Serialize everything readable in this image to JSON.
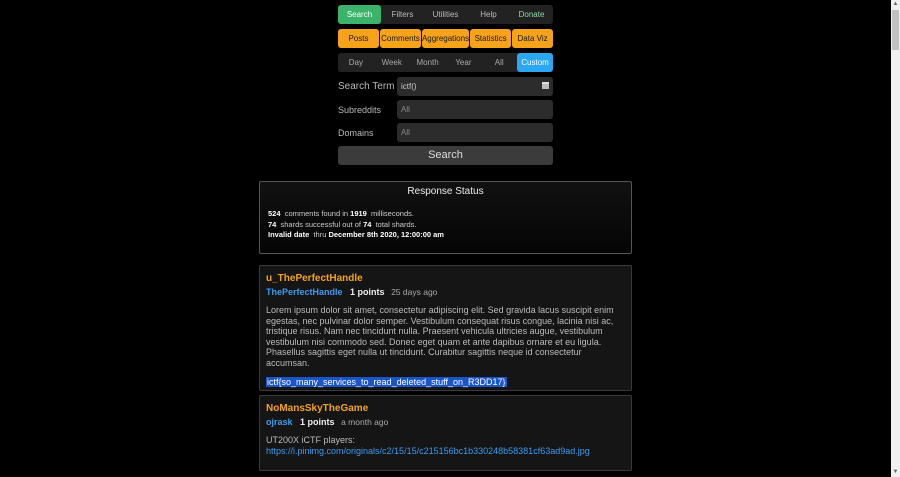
{
  "nav": {
    "main": [
      "Search",
      "Filters",
      "Utilities",
      "Help",
      "Donate"
    ],
    "types": [
      "Posts",
      "Comments",
      "Aggregations",
      "Statistics",
      "Data Viz"
    ],
    "time": [
      "Day",
      "Week",
      "Month",
      "Year",
      "All",
      "Custom"
    ]
  },
  "form": {
    "search_term_label": "Search Term",
    "search_term_value": "ictf()",
    "subreddits_label": "Subreddits",
    "subreddits_placeholder": "All",
    "domains_label": "Domains",
    "domains_placeholder": "All",
    "search_button": "Search"
  },
  "status": {
    "title": "Response Status",
    "count": "524",
    "count_text": "comments found in",
    "ms": "1919",
    "ms_text": "milliseconds.",
    "shards_ok": "74",
    "shards_text": "shards successful out of",
    "shards_total": "74",
    "shards_total_text": "total shards.",
    "date_start": "Invalid date",
    "thru": "thru",
    "date_end": "December 8th 2020, 12:00:00 am"
  },
  "posts": [
    {
      "subreddit": "u_ThePerfectHandle",
      "author": "ThePerfectHandle",
      "points": "1 points",
      "age": "25 days ago",
      "body": "Lorem ipsum dolor sit amet, consectetur adipiscing elit. Sed gravida lacus suscipit enim egestas, nec pulvinar dolor semper. Vestibulum consequat risus congue, lacinia nisi ac, tristique risus. Nam nec tincidunt nulla. Praesent vehicula ultricies augue, vestibulum vestibulum nisi commodo sed. Donec eget quam et ante dapibus ornare et eu ligula. Phasellus sagittis eget nulla ut tincidunt. Curabitur sagittis neque id consectetur accumsan.",
      "highlight": "ictf{so_many_services_to_read_deleted_stuff_on_R3DD17}"
    },
    {
      "subreddit": "NoMansSkyTheGame",
      "author": "ojrask",
      "points": "1 points",
      "age": "a month ago",
      "body": "UT200X iCTF players:",
      "link": "https://i.pinimg.com/originals/c2/15/15/c215156bc1b330248b58381cf63ad9ad.jpg"
    }
  ]
}
